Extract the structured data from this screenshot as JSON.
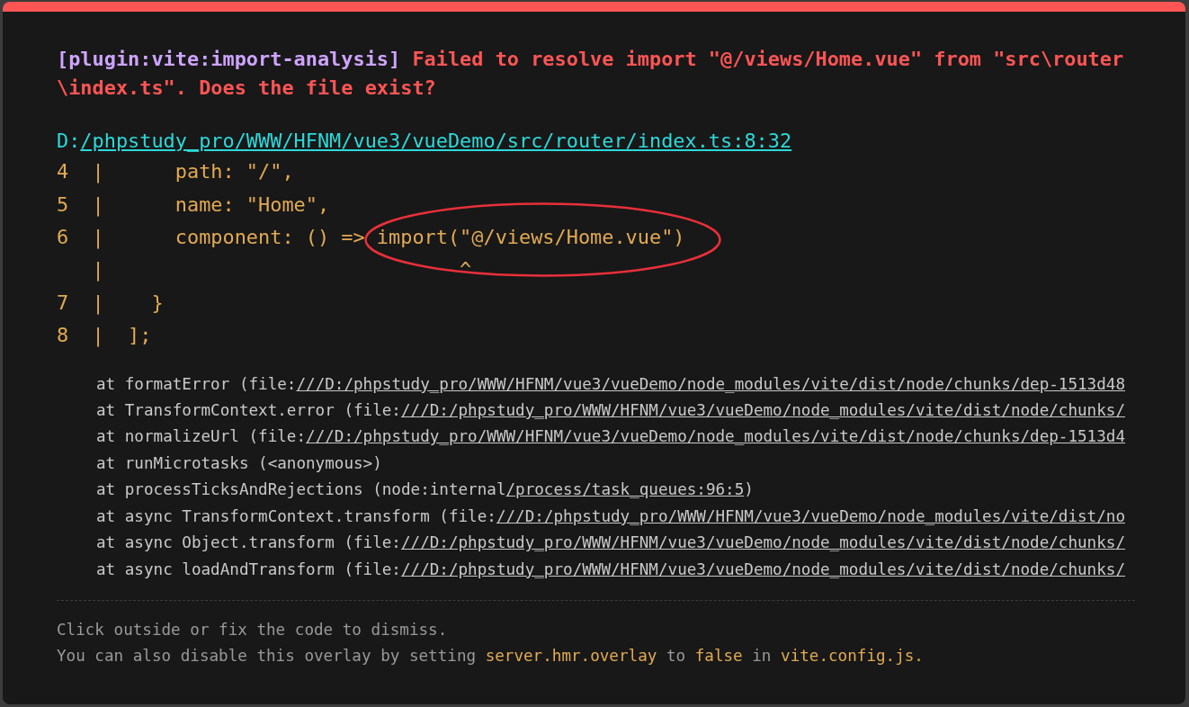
{
  "overlay": {
    "message": {
      "plugin": "[plugin:vite:import-analysis]",
      "text": "Failed to resolve import \"@/views/Home.vue\" from \"src\\router\\index.ts\". Does the file exist?"
    },
    "file": {
      "drive": "D:",
      "link": "/phpstudy_pro/WWW/HFNM/vue3/vueDemo/src/router/index.ts:8:32"
    },
    "frame": [
      "4  |      path: \"/\",",
      "5  |      name: \"Home\",",
      "6  |      component: () => import(\"@/views/Home.vue\")",
      "   |                              ^",
      "7  |    }",
      "8  |  ];"
    ],
    "stack": [
      {
        "text": "at formatError (file:",
        "link": "///D:/phpstudy_pro/WWW/HFNM/vue3/vueDemo/node_modules/vite/dist/node/chunks/dep-1513d48"
      },
      {
        "text": "at TransformContext.error (file:",
        "link": "///D:/phpstudy_pro/WWW/HFNM/vue3/vueDemo/node_modules/vite/dist/node/chunks/"
      },
      {
        "text": "at normalizeUrl (file:",
        "link": "///D:/phpstudy_pro/WWW/HFNM/vue3/vueDemo/node_modules/vite/dist/node/chunks/dep-1513d4"
      },
      {
        "text": "at runMicrotasks (<anonymous>)"
      },
      {
        "text": "at processTicksAndRejections (node:internal",
        "link": "/process/task_queues:96:5",
        "after": ")"
      },
      {
        "text": "at async TransformContext.transform (file:",
        "link": "///D:/phpstudy_pro/WWW/HFNM/vue3/vueDemo/node_modules/vite/dist/no"
      },
      {
        "text": "at async Object.transform (file:",
        "link": "///D:/phpstudy_pro/WWW/HFNM/vue3/vueDemo/node_modules/vite/dist/node/chunks/"
      },
      {
        "text": "at async loadAndTransform (file:",
        "link": "///D:/phpstudy_pro/WWW/HFNM/vue3/vueDemo/node_modules/vite/dist/node/chunks/"
      }
    ],
    "tip": {
      "line": "Click outside or fix the code to dismiss.",
      "parts": [
        {
          "kind": "plain",
          "text": "You can also disable this overlay by setting "
        },
        {
          "kind": "code",
          "text": "server.hmr.overlay"
        },
        {
          "kind": "plain",
          "text": " to "
        },
        {
          "kind": "code",
          "text": "false"
        },
        {
          "kind": "plain",
          "text": " in "
        },
        {
          "kind": "code",
          "text": "vite.config.js."
        }
      ]
    }
  }
}
